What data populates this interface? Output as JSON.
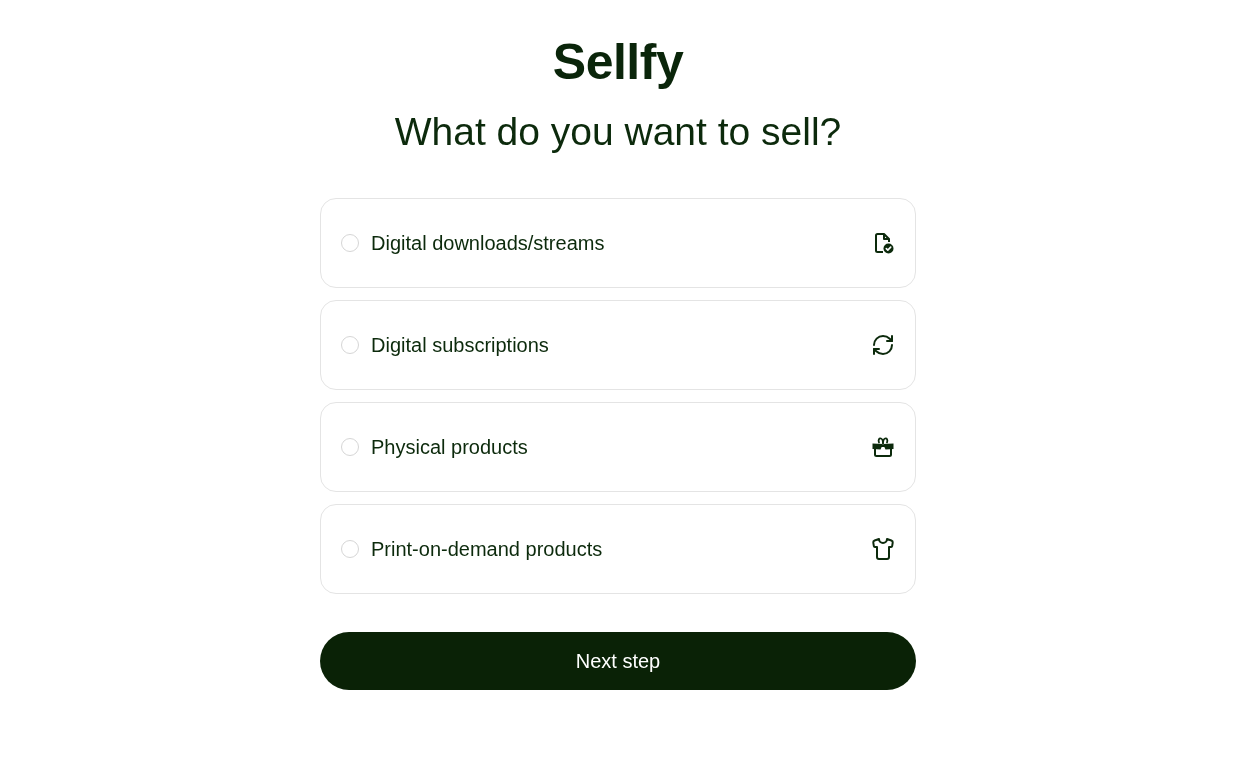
{
  "logo": "Sellfy",
  "heading": "What do you want to sell?",
  "options": [
    {
      "label": "Digital downloads/streams",
      "selected": false
    },
    {
      "label": "Digital subscriptions",
      "selected": false
    },
    {
      "label": "Physical products",
      "selected": false
    },
    {
      "label": "Print-on-demand products",
      "selected": false
    }
  ],
  "next_button": "Next step"
}
